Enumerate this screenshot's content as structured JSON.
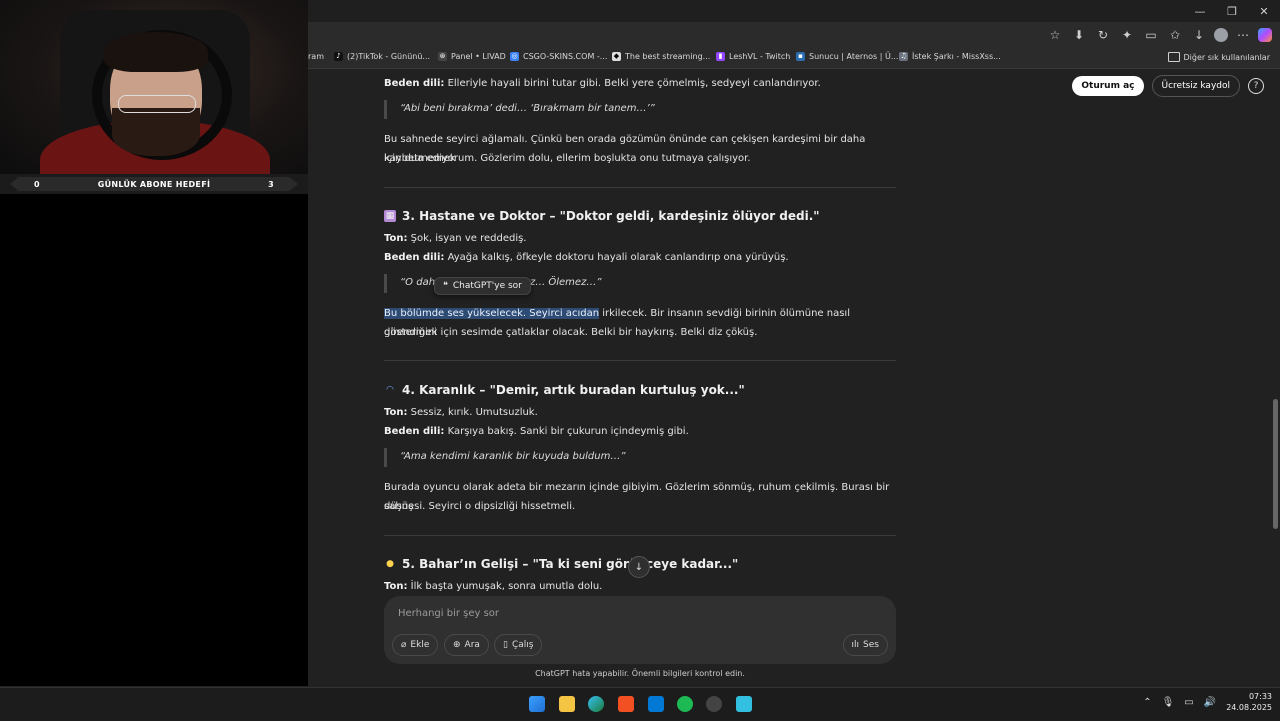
{
  "webcam": {
    "goal_left": "0",
    "goal_title": "GÜNLÜK ABONE HEDEFİ",
    "goal_right": "3"
  },
  "window": {
    "minimize": "—",
    "restore": "❐",
    "close": "✕"
  },
  "bookmarks": [
    {
      "label": "ram",
      "color": "#5a5a5a"
    },
    {
      "label": "(2)TikTok - Gününü...",
      "color": "#111111"
    },
    {
      "label": "Panel • LIVAD",
      "color": "#444444"
    },
    {
      "label": "CSGO-SKINS.COM -...",
      "color": "#3b82f6"
    },
    {
      "label": "The best streaming...",
      "color": "#dddddd"
    },
    {
      "label": "LeshVL - Twitch",
      "color": "#9146ff"
    },
    {
      "label": "Sunucu | Aternos | Ü...",
      "color": "#2b6cb0"
    },
    {
      "label": "İstek Şarkı - MissXss...",
      "color": "#6b7280"
    }
  ],
  "bookmarks_other": "Diğer sık kullanılanlar",
  "header": {
    "login": "Oturum aç",
    "signup": "Ücretsiz kaydol",
    "help": "?"
  },
  "article": {
    "s2_beden_label": "Beden dili:",
    "s2_beden": " Elleriyle hayali birini tutar gibi. Belki yere çömelmiş, sedyeyi canlandırıyor.",
    "s2_quote": "“Abi beni bırakma’ dedi… ‘Bırakmam bir tanem…’”",
    "s2_para1": "Bu sahnede seyirci ağlamalı. Çünkü ben orada gözümün önünde can çekişen kardeşimi bir daha kaybetmemek",
    "s2_para2": "için dua ediyorum. Gözlerim dolu, ellerim boşlukta onu tutmaya çalışıyor.",
    "s3_title": "3. Hastane ve Doktor – \"Doktor geldi, kardeşiniz ölüyor dedi.\"",
    "s3_ton_label": "Ton:",
    "s3_ton": " Şok, isyan ve reddediş.",
    "s3_beden_label": "Beden dili:",
    "s3_beden": " Ayağa kalkış, öfkeyle doktoru hayali olarak canlandırıp ona yürüyüş.",
    "s3_quote_a": "“O dah",
    "s3_quote_b": "mez… Ölemez…”",
    "s3_hl": "Bu bölümde ses yükselecek. Seyirci acıdan",
    "s3_para1_rest": " irkilecek. Bir insanın sevdiği birinin ölümüne nasıl direndiğini",
    "s3_para2": "göstermek için sesimde çatlaklar olacak. Belki bir haykırış. Belki diz çöküş.",
    "s4_title": "4. Karanlık – \"Demir, artık buradan kurtuluş yok...\"",
    "s4_ton_label": "Ton:",
    "s4_ton": " Sessiz, kırık. Umutsuzluk.",
    "s4_beden_label": "Beden dili:",
    "s4_beden": " Karşıya bakış. Sanki bir çukurun içindeymiş gibi.",
    "s4_quote": "“Ama kendimi karanlık bir kuyuda buldum…”",
    "s4_para1": "Burada oyuncu olarak adeta bir mezarın içinde gibiyim. Gözlerim sönmüş, ruhum çekilmiş. Burası bir düşüş",
    "s4_para2": "sahnesi. Seyirci o dipsizliği hissetmeli.",
    "s5_title": "5. Bahar’ın Gelişi – \"Ta ki seni görünceye kadar...\"",
    "s5_ton_label": "Ton:",
    "s5_ton": " İlk başta yumuşak, sonra umutla dolu."
  },
  "popover": {
    "label": "ChatGPT'ye sor",
    "icon": "quote-icon"
  },
  "composer": {
    "placeholder": "Herhangi bir şey sor",
    "add": "Ekle",
    "search": "Ara",
    "study": "Çalış",
    "voice": "Ses"
  },
  "disclaimer": "ChatGPT hata yapabilir. Önemli bilgileri kontrol edin.",
  "taskbar": {
    "time": "07:33",
    "date": "24.08.2025"
  },
  "colors": {
    "highlight": "#2e4b73",
    "page_bg": "#212121",
    "composer_bg": "#303030"
  }
}
